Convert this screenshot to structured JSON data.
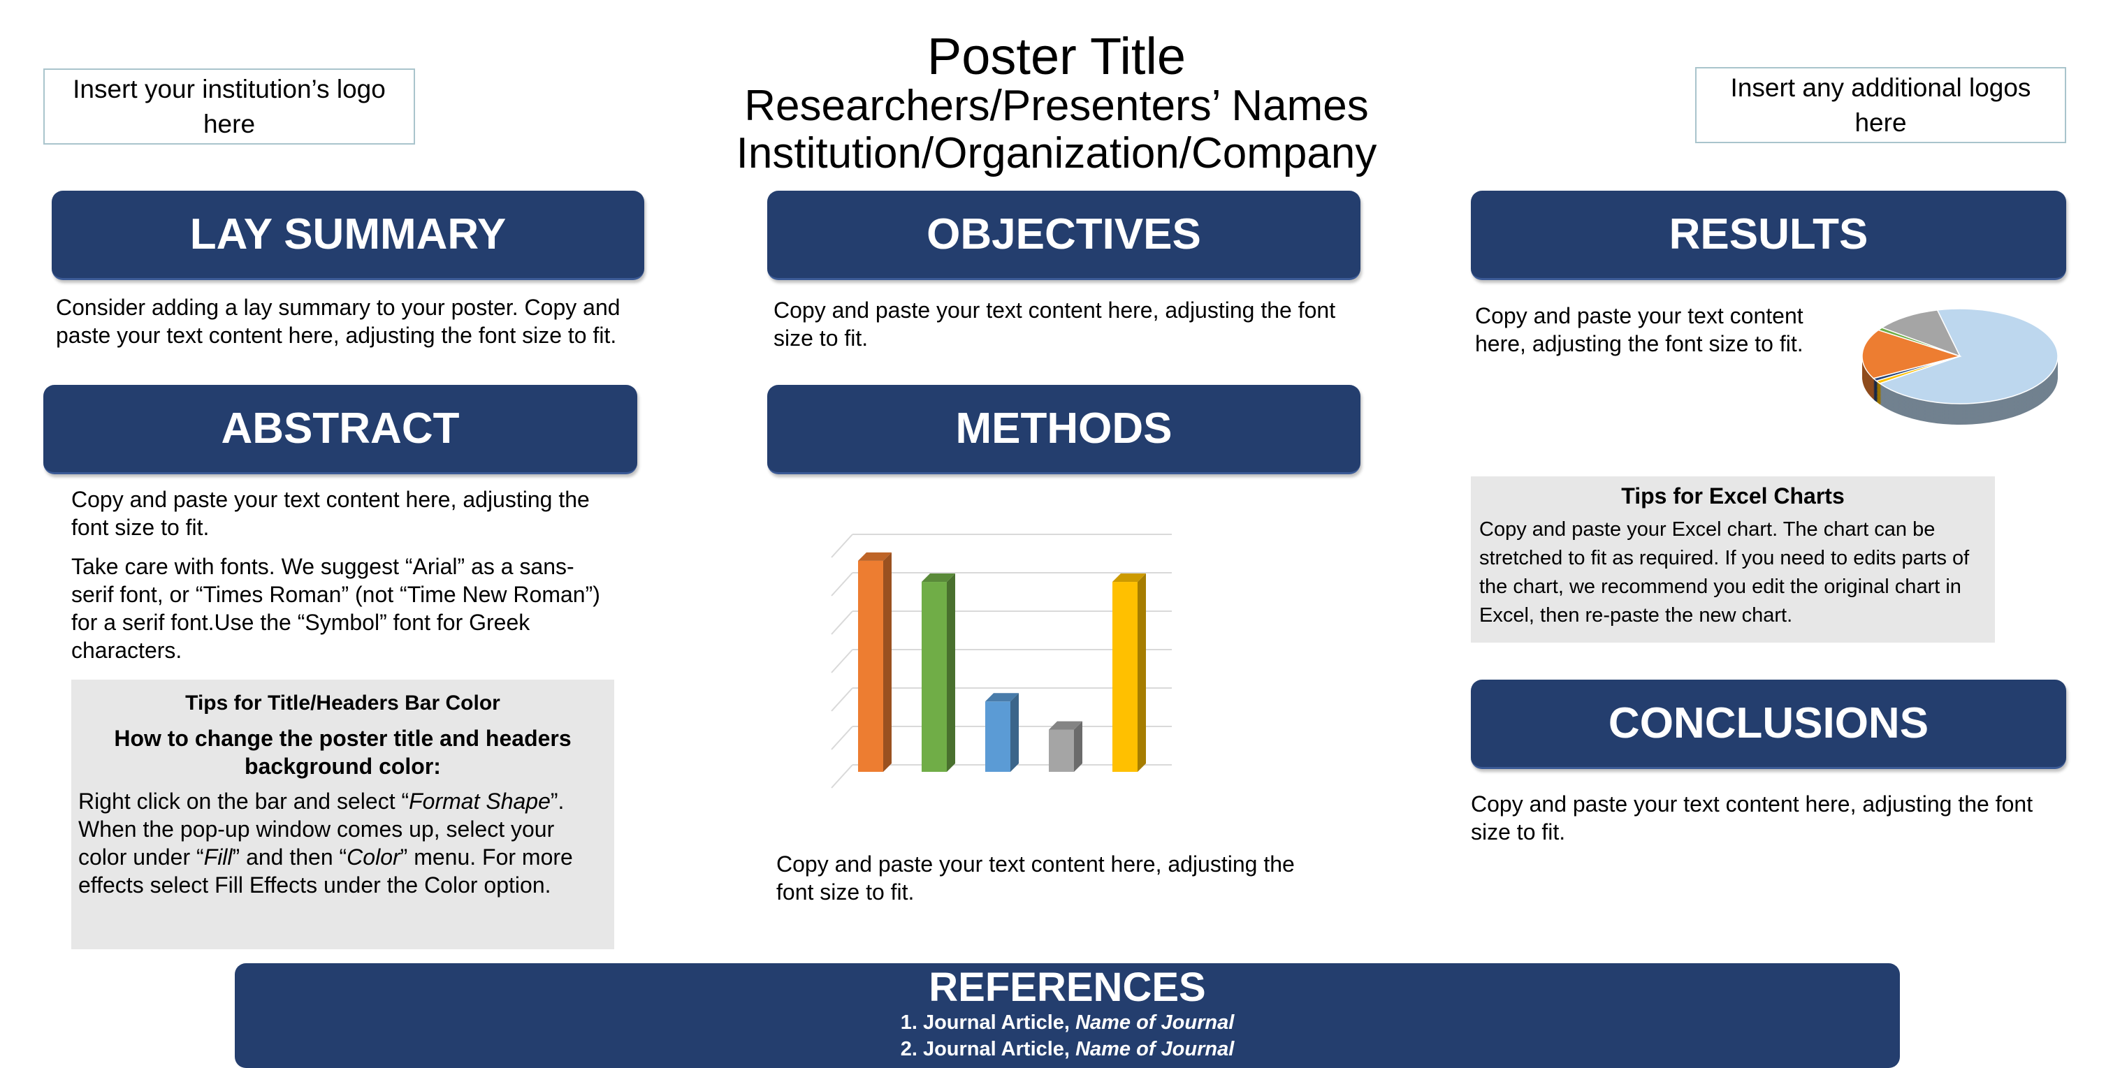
{
  "header": {
    "logo_left": "Insert your institution’s logo here",
    "logo_right": "Insert any additional logos here",
    "title": "Poster Title",
    "presenters": "Researchers/Presenters’ Names",
    "institution": "Institution/Organization/Company"
  },
  "colors": {
    "header_bar": "#243e6e",
    "tips_bg": "#e7e7e7",
    "logo_border": "#a9c4cc"
  },
  "lay_summary": {
    "heading": "LAY SUMMARY",
    "text": "Consider adding a lay summary to your poster. Copy and paste your text content here, adjusting the font size to fit."
  },
  "abstract": {
    "heading": "ABSTRACT",
    "p1": "Copy and paste your text content here, adjusting the font size to fit.",
    "p2": "Take care with fonts. We suggest “Arial” as a sans-serif font, or “Times Roman” (not “Time New Roman”) for a serif font.Use the “Symbol” font for Greek characters.",
    "tips": {
      "title": "Tips for Title/Headers Bar Color",
      "subtitle": "How to change the poster title and headers background color:",
      "t1": "Right click on the bar and select “",
      "t1i": "Format Shape",
      "t2": "”. When the pop-up window comes up, select your color under “",
      "t2i": "Fill",
      "t3": "” and then “",
      "t3i": "Color",
      "t4": "” menu. For more effects select Fill Effects under the Color option."
    }
  },
  "objectives": {
    "heading": "OBJECTIVES",
    "text": "Copy and paste your text content here, adjusting the font size to fit."
  },
  "methods": {
    "heading": "METHODS",
    "text": "Copy and paste your text content here, adjusting the font size to fit."
  },
  "results": {
    "heading": "RESULTS",
    "text": "Copy and paste your text content here, adjusting the font size to fit.",
    "tips": {
      "title": "Tips for Excel Charts",
      "text": "Copy and paste your Excel chart. The chart can be stretched to fit as required. If you need to edits parts of the chart, we recommend you edit the original chart in Excel, then re-paste the new chart."
    }
  },
  "conclusions": {
    "heading": "CONCLUSIONS",
    "text": "Copy and paste your text content here, adjusting the font size to fit."
  },
  "references": {
    "heading": "REFERENCES",
    "items": [
      {
        "num": "1.",
        "text": "Journal Article, ",
        "journal": "Name of Journal"
      },
      {
        "num": "2.",
        "text": "Journal Article, ",
        "journal": "Name of Journal"
      }
    ]
  },
  "chart_data": [
    {
      "type": "bar",
      "style": "3d-column",
      "grid": true,
      "ylim": [
        0,
        6.5
      ],
      "values": [
        6.0,
        5.4,
        2.0,
        1.2,
        5.4
      ],
      "colors": [
        "#ed7d31",
        "#70ad47",
        "#5b9bd5",
        "#a5a5a5",
        "#ffc000"
      ]
    },
    {
      "type": "pie",
      "style": "3d",
      "values": [
        69,
        11,
        1,
        17,
        1,
        1
      ],
      "colors": [
        "#bdd7ee",
        "#a5a5a5",
        "#70ad47",
        "#ed7d31",
        "#264478",
        "#ffc000"
      ]
    }
  ]
}
